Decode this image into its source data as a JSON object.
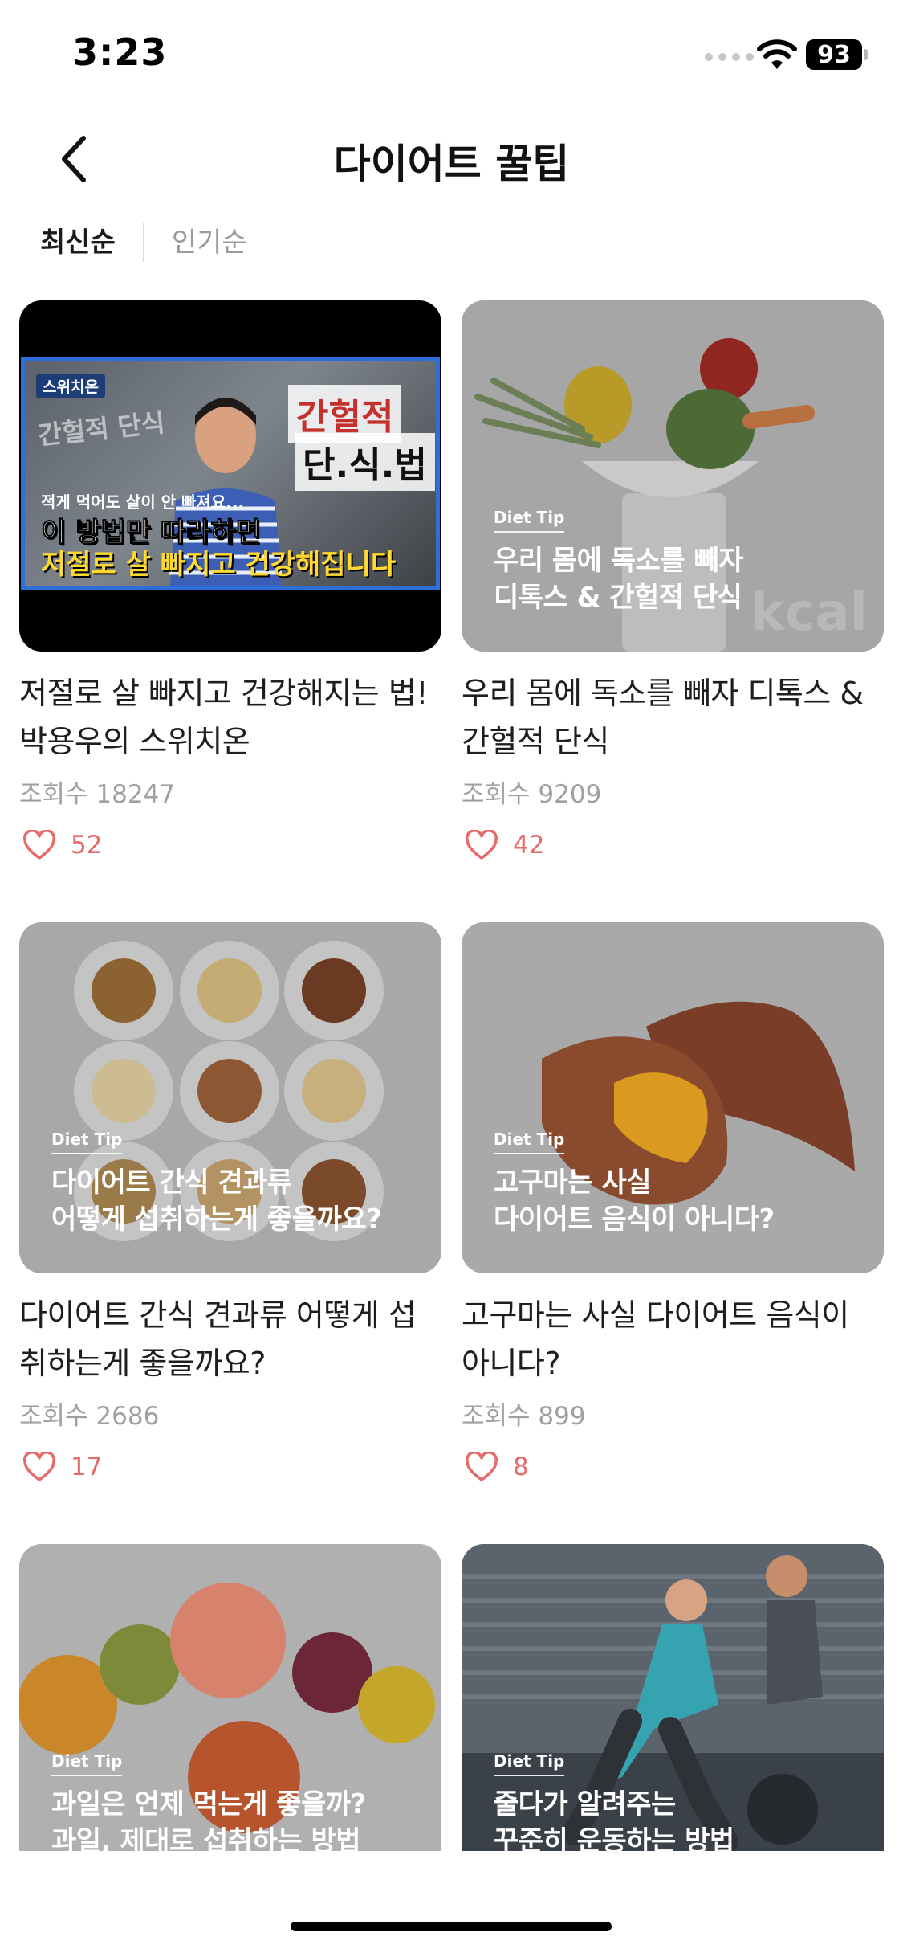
{
  "status_bar": {
    "time": "3:23",
    "battery": "93"
  },
  "nav": {
    "title": "다이어트 꿀팁"
  },
  "sort_tabs": [
    {
      "label": "최신순",
      "active": true
    },
    {
      "label": "인기순",
      "active": false
    }
  ],
  "tip_tag": "Diet Tip",
  "cards": [
    {
      "thumb_type": "video",
      "video": {
        "brand": "스위치온",
        "side_text_a": "간헐적 단식",
        "side_text_b": "간헐적",
        "side_text_c": "단.식.법",
        "small_caption": "적게 먹어도 살이 안 빠져요...",
        "line1": "이 방법만 따라하면",
        "line2": "저절로 살 빠지고 건강해집니다"
      },
      "title": "저절로 살 빠지고 건강해지는 법! 박용우의 스위치온",
      "views": "조회수 18247",
      "likes": "52"
    },
    {
      "thumb_type": "tip",
      "overlay": [
        "우리 몸에 독소를 빼자",
        "디톡스 & 간헐적 단식"
      ],
      "title": "우리 몸에 독소를 빼자 디톡스 & 간헐적 단식",
      "views": "조회수 9209",
      "likes": "42"
    },
    {
      "thumb_type": "tip",
      "overlay": [
        "다이어트 간식 견과류",
        "어떻게 섭취하는게 좋을까요?"
      ],
      "title": "다이어트 간식 견과류 어떻게 섭취하는게 좋을까요?",
      "views": "조회수 2686",
      "likes": "17"
    },
    {
      "thumb_type": "tip",
      "overlay": [
        "고구마는 사실",
        "다이어트 음식이 아니다?"
      ],
      "title": "고구마는 사실 다이어트 음식이 아니다?",
      "views": "조회수 899",
      "likes": "8"
    },
    {
      "thumb_type": "tip",
      "overlay": [
        "과일은 언제 먹는게 좋을까?",
        "과일, 제대로 섭취하는 방법"
      ],
      "title": "",
      "views": "",
      "likes": ""
    },
    {
      "thumb_type": "tip",
      "overlay": [
        "줄다가 알려주는",
        "꾸준히 운동하는 방법"
      ],
      "title": "",
      "views": "",
      "likes": ""
    }
  ],
  "icons": {
    "back": "chevron-left-icon",
    "wifi": "wifi-icon",
    "like": "heart-icon"
  },
  "colors": {
    "like_accent": "#e66a6a",
    "video_border": "#2d6fd6",
    "muted_text": "#a0a0a0"
  }
}
